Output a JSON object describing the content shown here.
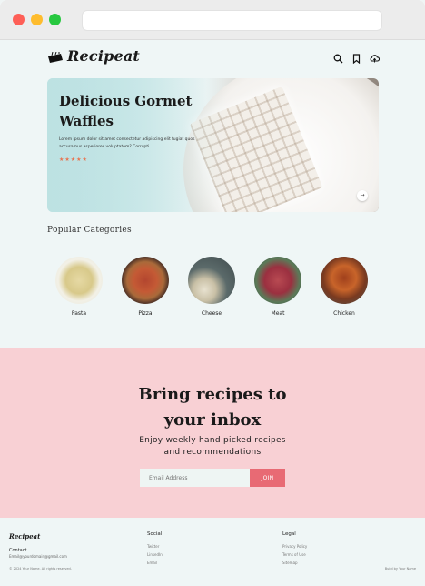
{
  "brand": {
    "name": "Recipeat"
  },
  "hero": {
    "title": "Delicious Gormet Waffles",
    "description": "Lorem ipsum dolor sit amet consectetur adipiscing elit fugiat quos accusamus asperiores voluptatem? Corrupti.",
    "rating": "★★★★★",
    "arrow": "→"
  },
  "categories": {
    "title": "Popular Categories",
    "items": [
      {
        "label": "Pasta"
      },
      {
        "label": "Pizza"
      },
      {
        "label": "Cheese"
      },
      {
        "label": "Meat"
      },
      {
        "label": "Chicken"
      }
    ]
  },
  "newsletter": {
    "title_line1": "Bring recipes to",
    "title_line2": "your inbox",
    "subtitle_line1": "Enjoy weekly hand picked recipes",
    "subtitle_line2": "and recommendations",
    "placeholder": "Email Address",
    "button": "JOIN"
  },
  "footer": {
    "logo": "Recipeat",
    "contact_label": "Contact",
    "email": "Email@yourdomain@gmail.com",
    "copyright": "© 2024 Your Name. All rights reserved.",
    "social": {
      "heading": "Social",
      "links": [
        "Twitter",
        "LinkedIn",
        "Email"
      ]
    },
    "legal": {
      "heading": "Legal",
      "links": [
        "Privacy Policy",
        "Terms of Use",
        "Sitemap"
      ]
    },
    "credit": "Build by Your Name"
  },
  "colors": {
    "accent": "#e86a74",
    "newsletter_bg": "#f8d0d4",
    "page_bg": "#eff6f6",
    "stars": "#e8734f"
  }
}
